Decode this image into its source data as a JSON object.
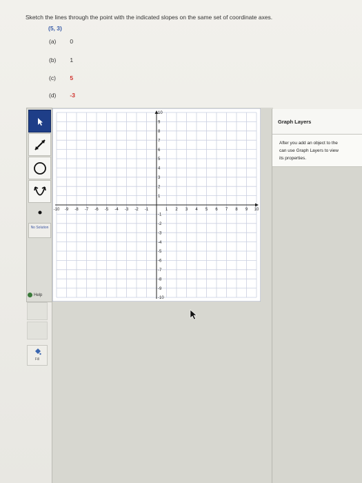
{
  "question": {
    "instruction": "Sketch the lines through the point with the indicated slopes on the same set of coordinate axes.",
    "point": "(5, 3)",
    "parts": [
      {
        "label": "(a)",
        "slope": "0",
        "color": "#333333"
      },
      {
        "label": "(b)",
        "slope": "1",
        "color": "#333333"
      },
      {
        "label": "(c)",
        "slope": "5",
        "color": "#d0302a"
      },
      {
        "label": "(d)",
        "slope": "-3",
        "color": "#d0302a"
      }
    ]
  },
  "toolbar": {
    "tools": [
      {
        "name": "select-tool",
        "icon": "arrow-pointer-icon",
        "selected": true
      },
      {
        "name": "line-tool",
        "icon": "line-segment-icon",
        "selected": false
      },
      {
        "name": "circle-tool",
        "icon": "circle-icon",
        "selected": false
      },
      {
        "name": "parabola-tool",
        "icon": "parabola-icon",
        "selected": false
      },
      {
        "name": "point-tool",
        "icon": "dot-icon",
        "selected": false
      }
    ],
    "no_solution_label": "No Solution",
    "help_label": "Help",
    "fill_label": "Fill"
  },
  "graph": {
    "x_min": -10,
    "x_max": 10,
    "y_min": -10,
    "y_max": 10,
    "x_tick_labels": [
      "-10",
      "-9",
      "-8",
      "-7",
      "-6",
      "-5",
      "-4",
      "-3",
      "-2",
      "-1",
      "1",
      "2",
      "3",
      "4",
      "5",
      "6",
      "7",
      "8",
      "9",
      "10"
    ],
    "y_tick_labels": [
      "10",
      "9",
      "8",
      "7",
      "6",
      "5",
      "4",
      "3",
      "2",
      "1",
      "-1",
      "-2",
      "-3",
      "-4",
      "-5",
      "-6",
      "-7",
      "-8",
      "-9",
      "-10"
    ],
    "grid_color": "#c9cfe0",
    "axis_color": "#222222"
  },
  "layers": {
    "title": "Graph Layers",
    "description": "After you add an object to the graph you can use Graph Layers to view and edit its properties.",
    "description_visible": "After you add an object to the\ncan use Graph Layers to view\nits properties."
  }
}
